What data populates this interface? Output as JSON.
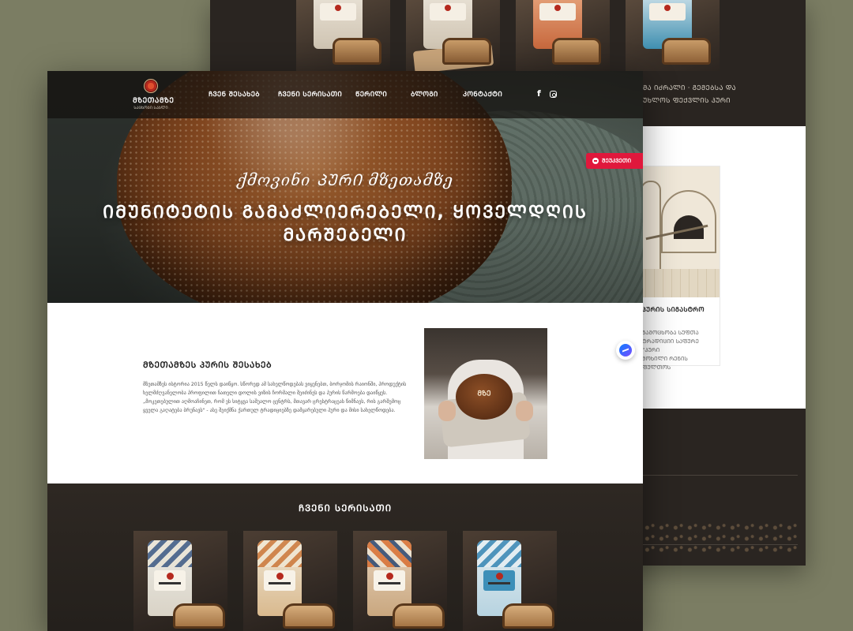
{
  "back_page": {
    "text_lines": [
      "ᲛᲐ ᲘᲫᲠᲐᲚᲘ · ᲒᲔᲛᲔᲑᲡᲐ ᲓᲐ",
      "ᲣᲮᲚᲝᲡ ᲤᲔᲥᲕᲚᲘᲡ ᲞᲣᲠᲘ"
    ],
    "blog_card": {
      "title": "ᲞᲣᲠᲘᲡ ᲡᲘᲒᲐᲡᲢᲠᲝ",
      "lines": [
        "ᲒᲐᲛᲝᲪᲮᲝᲑᲐ ᲡᲣᲤᲗᲐ",
        "ᲢᲠᲐᲓᲘᲪᲘᲘ ᲡᲐᲤᲣᲠᲔ \"ᲞᲣᲠᲘ",
        "ᲛᲝᲮᲘᲚᲘ ᲠᲔᲜᲘᲡ ᲤᲣᲚᲗᲝᲡ"
      ]
    }
  },
  "brand": {
    "name": "ᲛᲖᲔᲗᲐᲛᲖᲔ",
    "tagline": "ᲡᲐᲪᲮᲝᲑᲘ ᲡᲐᲮᲚᲘ"
  },
  "nav": {
    "items": [
      "ᲩᲕᲔᲜ ᲨᲔᲡᲐᲮᲔᲑ",
      "ᲩᲕᲔᲜᲘ ᲡᲔᲠᲘᲡᲐᲗᲘ",
      "ᲬᲔᲠᲘᲚᲘ",
      "ᲑᲚᲝᲒᲘ",
      "ᲙᲝᲜᲢᲐᲥᲢᲘ"
    ],
    "social": [
      "facebook-icon",
      "instagram-icon"
    ]
  },
  "hero": {
    "script_title": "ქმოვინი ᲞᲣᲠᲘ მზეთამზე",
    "headline": "ᲘᲛᲣᲜᲘᲢᲔᲢᲘᲡ ᲒᲐᲛᲐᲫᲚᲘᲔᲠᲔᲑᲔᲚᲘ, ᲧᲝᲕᲔᲚᲓᲦᲘᲡ ᲛᲐᲠᲨᲔᲑᲔᲚᲘ",
    "order_button": "ᲨᲔᲣᲙᲕᲔᲗᲘ"
  },
  "about": {
    "title": "ᲛᲖᲔᲗᲐᲛᲖᲔᲡ ᲞᲣᲠᲘᲡ ᲨᲔᲡᲐᲮᲔᲑ",
    "paragraph_lines": [
      "მზეთამზეს ისტორია 2015 წელს დაიწყო. სწორედ ამ სახელწოდებას ვიყენებთ, ბორჯომის რაიონში, პროდუქტის",
      "ხელმძღვანელობა პროფილით ნათელი დოლის ვიზის ჩორმალი შეიძინეს და პურის წარმოება დაიწყეს.",
      "„მოკეთებულით აღმოაჩინეთ, რომ ეს სიტყვა საშუალო ცენტრს, მთავარ ცრესტრაცეას წიმნავს, რის გარშემოც",
      "ყველა გაღატება ბრუნავს\" - ასე შეიქმნა ქართულ ტრადიციებზე დამყარებული პური და მისი სახელწოდება."
    ]
  },
  "products": {
    "title": "ᲩᲕᲔᲜᲘ ᲡᲔᲠᲘᲡᲐᲗᲘ",
    "count": 4
  }
}
